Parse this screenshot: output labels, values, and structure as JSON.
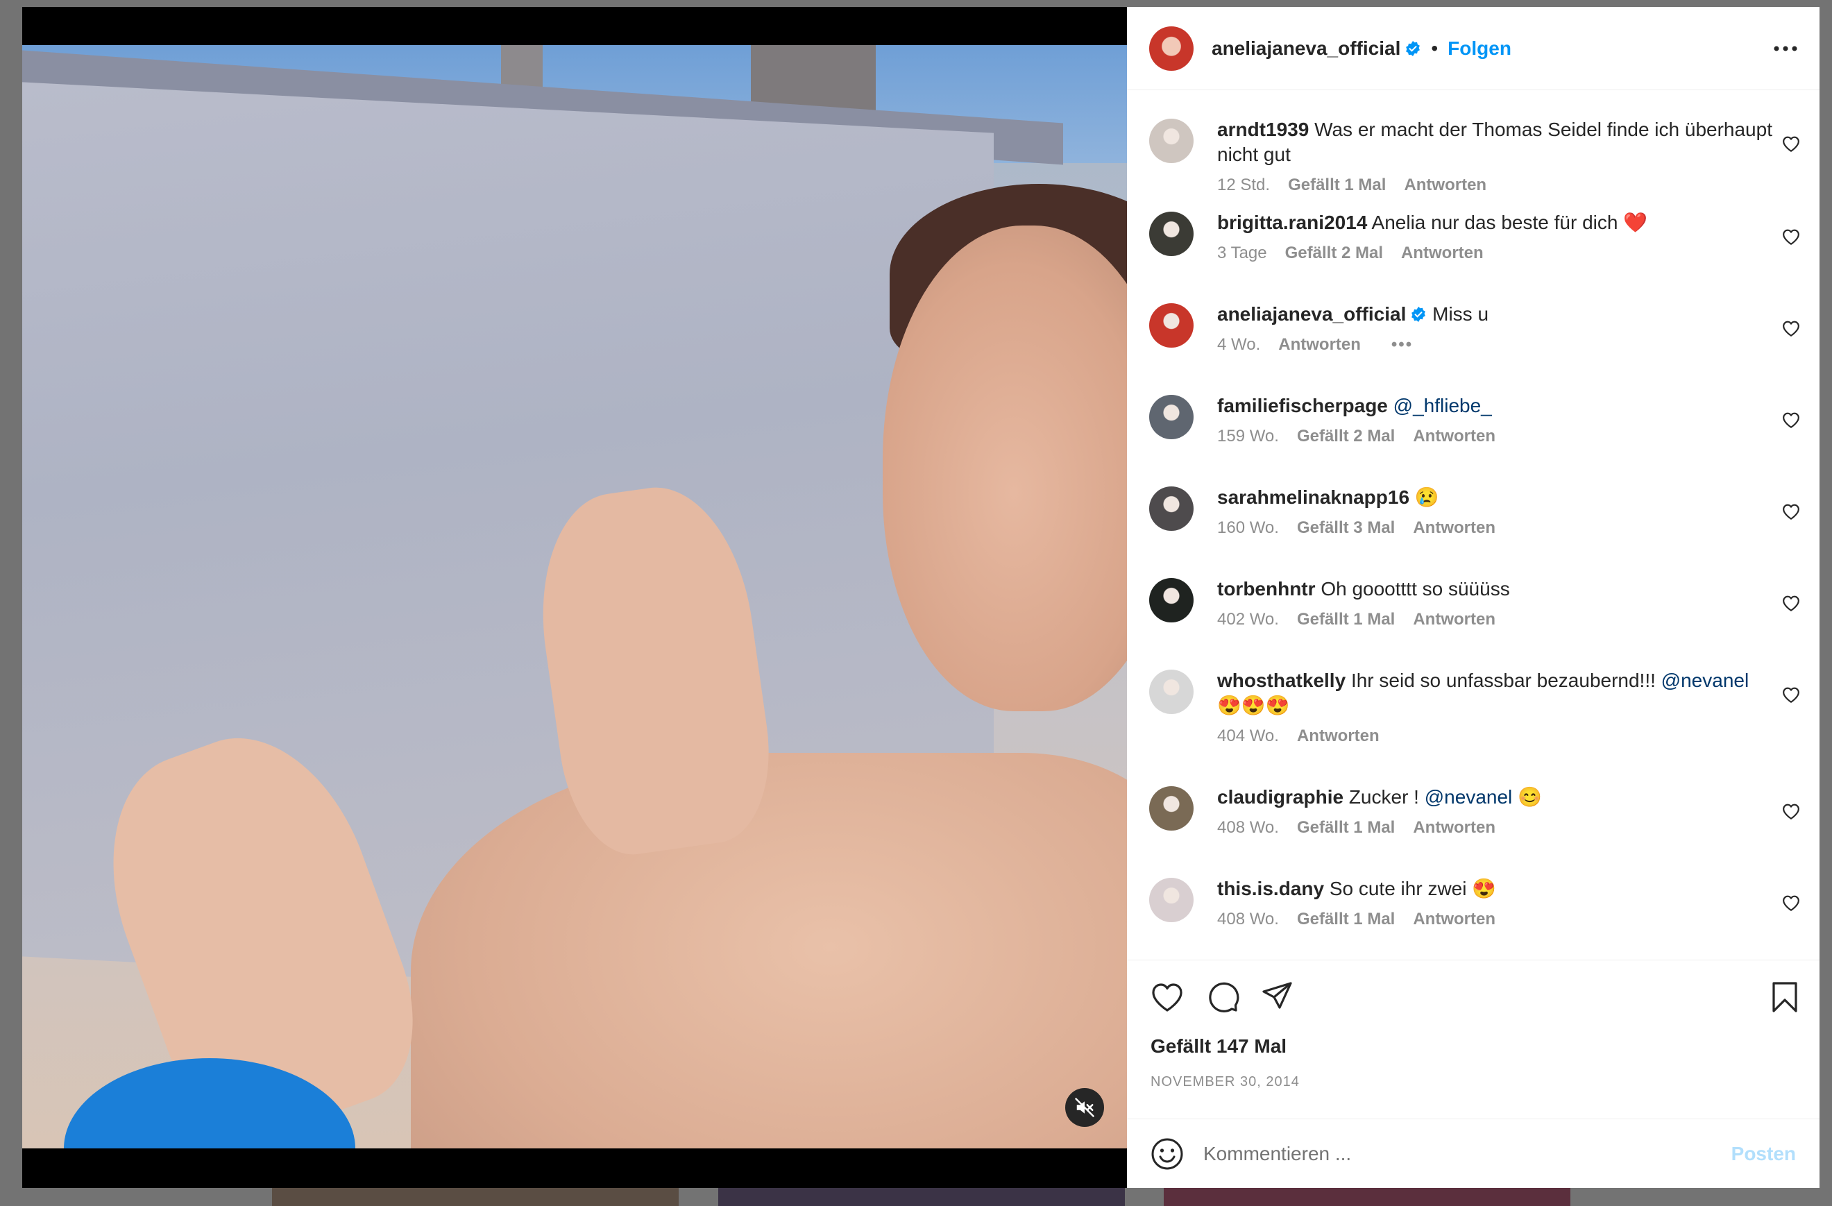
{
  "post": {
    "author": "aneliajaneva_official",
    "follow_label": "Folgen",
    "separator": "•",
    "likes_label": "Gefällt 147 Mal",
    "date_label": "NOVEMBER 30, 2014"
  },
  "comments": [
    {
      "user": "arndt1939",
      "text": "Was er macht der Thomas Seidel finde ich überhaupt nicht gut",
      "mention": "",
      "emoji": "",
      "time": "12 Std.",
      "likes": "Gefällt 1 Mal",
      "reply": "Antworten",
      "verified": false,
      "avatar_color": "#cfc6c0"
    },
    {
      "user": "brigitta.rani2014",
      "text": "Anelia nur das beste für dich",
      "mention": "",
      "emoji": "❤️",
      "time": "3 Tage",
      "likes": "Gefällt 2 Mal",
      "reply": "Antworten",
      "verified": false,
      "avatar_color": "#3b3b35"
    },
    {
      "user": "aneliajaneva_official",
      "text": "Miss u",
      "mention": "",
      "emoji": "",
      "time": "4 Wo.",
      "likes": "",
      "reply": "Antworten",
      "verified": true,
      "avatar_color": "#c8362a",
      "more": "•••"
    },
    {
      "user": "familiefischerpage",
      "text": "",
      "mention": "@_hfliebe_",
      "emoji": "",
      "time": "159 Wo.",
      "likes": "Gefällt 2 Mal",
      "reply": "Antworten",
      "verified": false,
      "avatar_color": "#5f6670"
    },
    {
      "user": "sarahmelinaknapp16",
      "text": "",
      "mention": "",
      "emoji": "😢",
      "time": "160 Wo.",
      "likes": "Gefällt 3 Mal",
      "reply": "Antworten",
      "verified": false,
      "avatar_color": "#4e4b4d"
    },
    {
      "user": "torbenhntr",
      "text": "Oh goootttt so süüüss",
      "mention": "",
      "emoji": "",
      "time": "402 Wo.",
      "likes": "Gefällt 1 Mal",
      "reply": "Antworten",
      "verified": false,
      "avatar_color": "#1f2320"
    },
    {
      "user": "whosthatkelly",
      "text": "Ihr seid so unfassbar bezaubernd!!!",
      "mention": "@nevanel",
      "emoji": "😍😍😍",
      "time": "404 Wo.",
      "likes": "",
      "reply": "Antworten",
      "verified": false,
      "avatar_color": "#d7d7d7"
    },
    {
      "user": "claudigraphie",
      "text": "Zucker !",
      "mention": "@nevanel",
      "emoji": "😊",
      "time": "408 Wo.",
      "likes": "Gefällt 1 Mal",
      "reply": "Antworten",
      "verified": false,
      "avatar_color": "#7a6a55"
    },
    {
      "user": "this.is.dany",
      "text": "So cute ihr zwei",
      "mention": "",
      "emoji": "😍",
      "time": "408 Wo.",
      "likes": "Gefällt 1 Mal",
      "reply": "Antworten",
      "verified": false,
      "avatar_color": "#d9cfd1"
    }
  ],
  "composer": {
    "placeholder": "Kommentieren ...",
    "post_label": "Posten"
  },
  "icons": {
    "more": "more-options-icon",
    "mute": "muted-speaker-icon",
    "like": "heart-icon",
    "comment": "comment-bubble-icon",
    "share": "paper-plane-icon",
    "save": "bookmark-icon",
    "emoji": "emoji-smiley-icon"
  },
  "colors": {
    "accent": "#0095f6",
    "mention": "#00376b",
    "meta": "#8e8e8e",
    "post_disabled": "#b2dffc"
  }
}
